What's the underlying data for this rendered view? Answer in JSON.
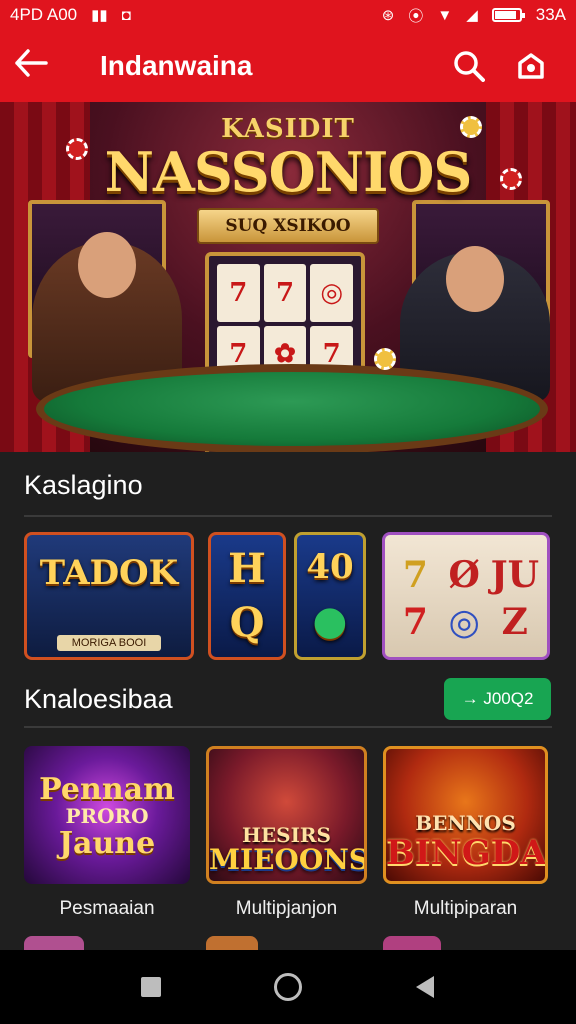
{
  "status_bar": {
    "left_text": "4PD A00",
    "time": "33A",
    "battery_level": 0.9
  },
  "app_bar": {
    "title": "Indanwaina"
  },
  "hero": {
    "sign_top": "KASIDIT",
    "sign_main": "NASSONIOS",
    "ribbon": "SUQ XSIKOO",
    "slot_symbols": [
      "7",
      "7",
      "◎",
      "7",
      "✿",
      "7",
      "▲",
      "◉",
      "◎"
    ]
  },
  "section1": {
    "title": "Kaslagino",
    "tiles": [
      {
        "text": "TADOK",
        "caption": "MORIGA BOOI"
      },
      {
        "top": "H",
        "bottom": "Q"
      },
      {
        "top": "40",
        "bottom": "●"
      },
      {
        "symbols": [
          "7",
          "Ø",
          "JU",
          "7",
          "◎",
          "Z"
        ]
      }
    ]
  },
  "section2": {
    "title": "Knaloesibaa",
    "see_all_label": "→ J00Q2",
    "games": [
      {
        "art_text_1": "Pennam",
        "art_text_2": "PRORO",
        "art_text_3": "Jaune",
        "caption": "Pesmaaian"
      },
      {
        "art_text_1": "HESIRS",
        "art_text_2": "MIEOONS",
        "caption": "Multipjanjon"
      },
      {
        "art_text_1": "BENNOS",
        "art_text_2": "BINGDAS",
        "caption": "Multipiparan"
      }
    ]
  },
  "colors": {
    "brand_red": "#e0141e",
    "accent_green": "#18a552",
    "background": "#1f1f1f"
  }
}
